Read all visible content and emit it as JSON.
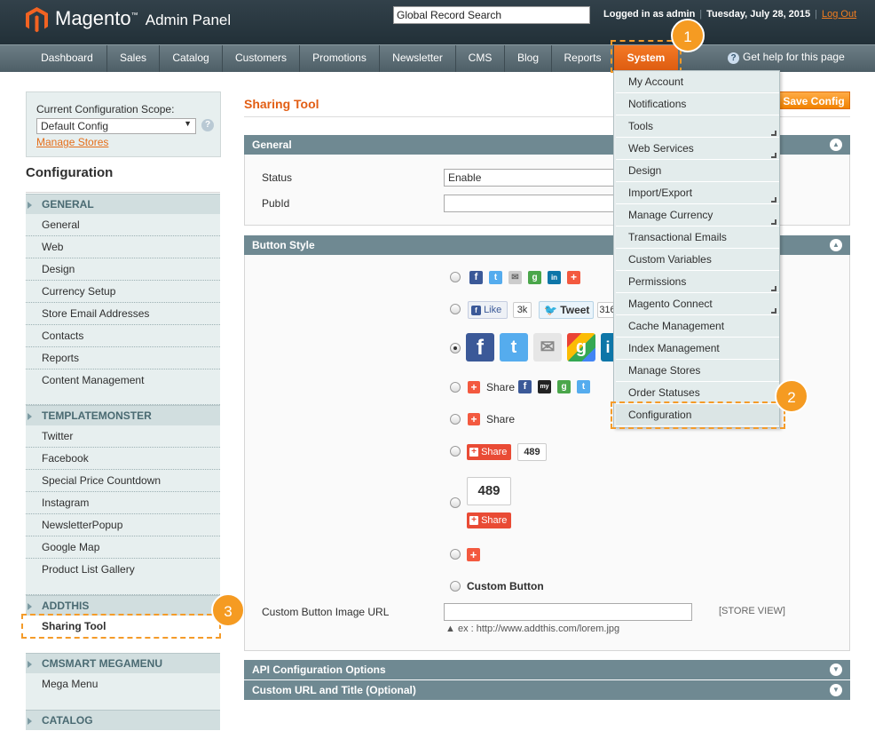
{
  "header": {
    "brand": "Magento",
    "brand_suffix": "Admin Panel",
    "search_value": "Global Record Search",
    "logged_in": "Logged in as admin",
    "date": "Tuesday, July 28, 2015",
    "logout": "Log Out",
    "help": "Get help for this page"
  },
  "nav": {
    "items": [
      "Dashboard",
      "Sales",
      "Catalog",
      "Customers",
      "Promotions",
      "Newsletter",
      "CMS",
      "Blog",
      "Reports",
      "System"
    ]
  },
  "badges": [
    "1",
    "2",
    "3"
  ],
  "scope": {
    "label": "Current Configuration Scope:",
    "selected": "Default Config",
    "manage_stores": "Manage Stores"
  },
  "sidebar": {
    "title": "Configuration",
    "groups": [
      {
        "title": "GENERAL",
        "items": [
          "General",
          "Web",
          "Design",
          "Currency Setup",
          "Store Email Addresses",
          "Contacts",
          "Reports",
          "Content Management"
        ]
      },
      {
        "title": "TEMPLATEMONSTER",
        "items": [
          "Twitter",
          "Facebook",
          "Special Price Countdown",
          "Instagram",
          "NewsletterPopup",
          "Google Map",
          "Product List Gallery"
        ]
      },
      {
        "title": "ADDTHIS",
        "items": [
          "Sharing Tool"
        ]
      },
      {
        "title": "CMSMART MEGAMENU",
        "items": [
          "Mega Menu"
        ]
      },
      {
        "title": "CATALOG",
        "items": []
      }
    ]
  },
  "main": {
    "title": "Sharing Tool",
    "save": "Save Config",
    "general": {
      "title": "General",
      "status_label": "Status",
      "status_value": "Enable",
      "pubid_label": "PubId"
    },
    "button_style": {
      "title": "Button Style",
      "like": "Like",
      "like_count": "3k",
      "tweet": "Tweet",
      "tweet_count": "316",
      "share": "Share",
      "share2": "Share",
      "share_badge": "Share",
      "count": "489",
      "count_big": "489",
      "share_big": "Share",
      "custom_button": "Custom Button",
      "custom_url_label": "Custom Button Image URL",
      "store_view": "[STORE VIEW]",
      "hint": "ex : http://www.addthis.com/lorem.jpg"
    },
    "api_section": "API Configuration Options",
    "custom_url_section": "Custom URL and Title (Optional)"
  },
  "system_menu": {
    "items": [
      {
        "label": "My Account",
        "sub": false
      },
      {
        "label": "Notifications",
        "sub": false
      },
      {
        "label": "Tools",
        "sub": true
      },
      {
        "label": "Web Services",
        "sub": true
      },
      {
        "label": "Design",
        "sub": false
      },
      {
        "label": "Import/Export",
        "sub": true
      },
      {
        "label": "Manage Currency",
        "sub": true
      },
      {
        "label": "Transactional Emails",
        "sub": false
      },
      {
        "label": "Custom Variables",
        "sub": false
      },
      {
        "label": "Permissions",
        "sub": true
      },
      {
        "label": "Magento Connect",
        "sub": true
      },
      {
        "label": "Cache Management",
        "sub": false
      },
      {
        "label": "Index Management",
        "sub": false
      },
      {
        "label": "Manage Stores",
        "sub": false
      },
      {
        "label": "Order Statuses",
        "sub": false
      },
      {
        "label": "Configuration",
        "sub": false
      }
    ]
  },
  "icons": {
    "facebook": "f",
    "twitter": "t",
    "email": "✉",
    "google": "g",
    "linkedin": "in",
    "plus": "+",
    "myspace": "my"
  },
  "colors": {
    "accent": "#f18200",
    "header": "#223038",
    "nav": "#5a6b73",
    "section": "#6f8992",
    "highlight": "#f59b22"
  }
}
